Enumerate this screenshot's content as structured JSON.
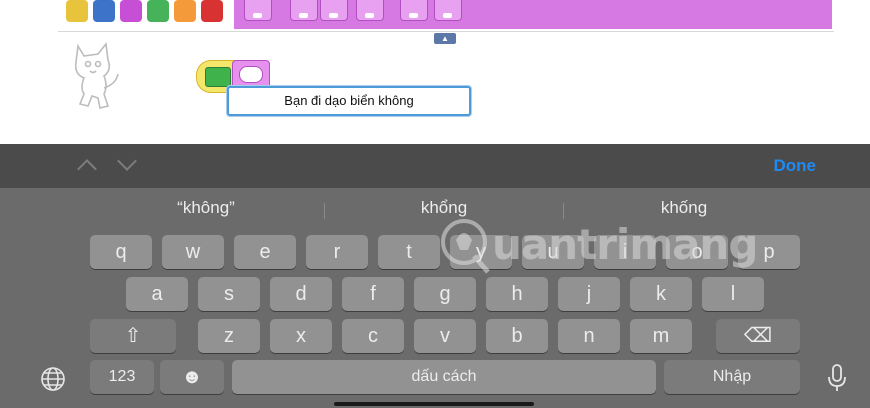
{
  "app": {
    "speech_text": "Bạn đi dạo biển không",
    "expand_glyph": "▲",
    "strip_scroll_glyph": "⇲",
    "colors": {
      "palette": [
        "#e7c43b",
        "#3d73c8",
        "#c74fd6",
        "#46b35a",
        "#f59a3a",
        "#d93232"
      ],
      "block_strip": "#d779e2"
    }
  },
  "keyboard": {
    "done_label": "Done",
    "suggestions": [
      "“không”",
      "khổng",
      "khống"
    ],
    "row1": [
      "q",
      "w",
      "e",
      "r",
      "t",
      "y",
      "u",
      "i",
      "o",
      "p"
    ],
    "row2": [
      "a",
      "s",
      "d",
      "f",
      "g",
      "h",
      "j",
      "k",
      "l"
    ],
    "row3": [
      "z",
      "x",
      "c",
      "v",
      "b",
      "n",
      "m"
    ],
    "shift_glyph": "⇧",
    "backspace_glyph": "⌫",
    "numbers_label": "123",
    "emoji_glyph": "☻",
    "space_label": "dấu cách",
    "return_label": "Nhập",
    "icons": {
      "globe": "globe-icon",
      "mic": "microphone-icon",
      "prev": "chevron-up-icon",
      "next": "chevron-down-icon"
    }
  },
  "watermark": {
    "text": "uantrimang"
  }
}
